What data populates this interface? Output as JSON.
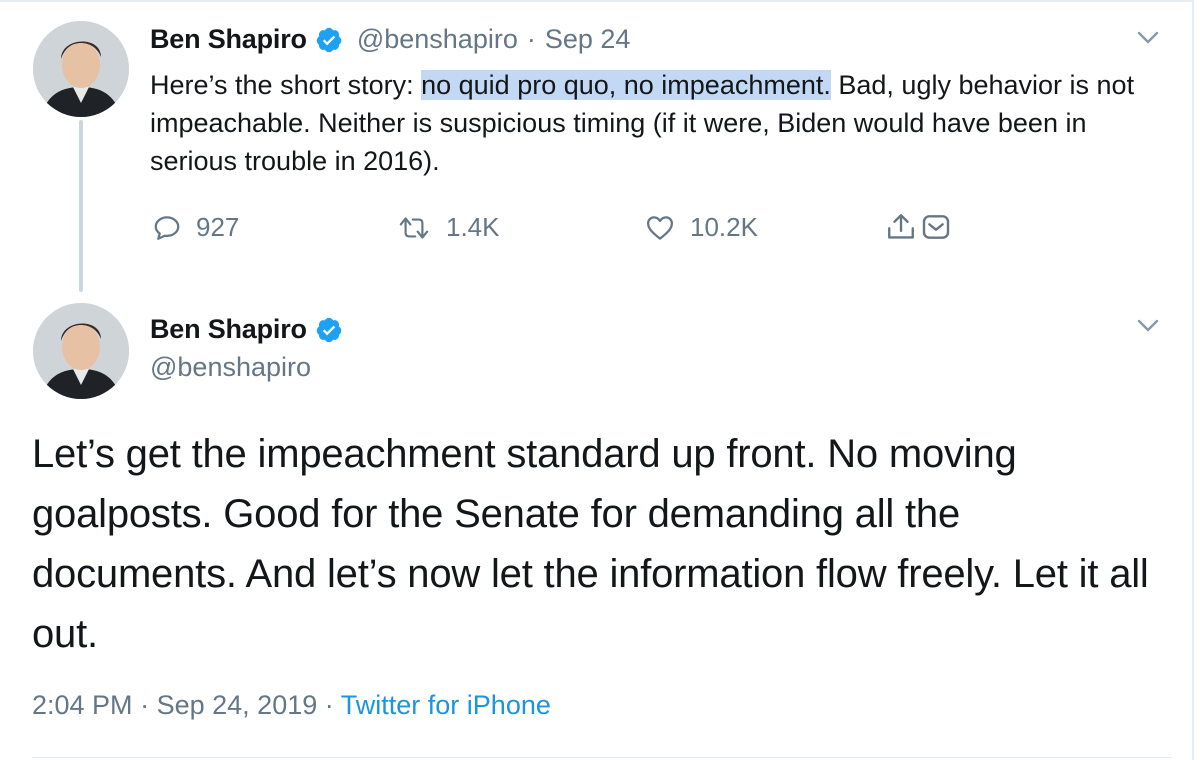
{
  "tweet1": {
    "name": "Ben Shapiro",
    "handle": "@benshapiro",
    "separator": "·",
    "date": "Sep 24",
    "text_before": "Here’s the short story: ",
    "text_highlight": "no quid pro quo, no impeachment.",
    "text_after": " Bad, ugly behavior is not impeachable. Neither is suspicious timing (if it were, Biden would have been in serious trouble in 2016).",
    "replies": "927",
    "retweets": "1.4K",
    "likes": "10.2K"
  },
  "tweet2": {
    "name": "Ben Shapiro",
    "handle": "@benshapiro",
    "text": "Let’s get the impeachment standard up front. No moving goalposts. Good for the Senate for demanding all the documents. And let’s now let the information flow freely. Let it all out.",
    "time": "2:04 PM",
    "sep1": "·",
    "date": "Sep 24, 2019",
    "sep2": "·",
    "source": "Twitter for iPhone"
  },
  "icons": {
    "reply": "reply-icon",
    "retweet": "retweet-icon",
    "like": "heart-icon",
    "share": "share-icon",
    "dm": "dm-icon",
    "verified": "verified-badge-icon",
    "caret": "chevron-down-icon"
  },
  "colors": {
    "verified": "#1da1f2",
    "link": "#1b95e0",
    "secondary": "#657786",
    "highlight": "#c3d8f4"
  }
}
